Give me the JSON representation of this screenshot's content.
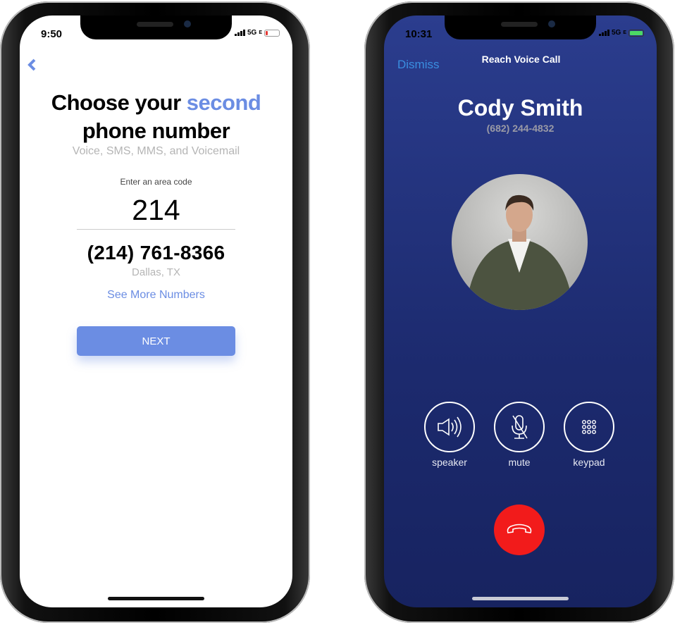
{
  "left_phone": {
    "status": {
      "time": "9:50",
      "network": "5G",
      "network_suffix": "E",
      "battery_color": "#e53935"
    },
    "back_icon": "chevron-left-icon",
    "title_part1": "Choose your ",
    "title_highlight": "second",
    "title_line2": "phone number",
    "subtitle": "Voice, SMS, MMS, and Voicemail",
    "area_code_label": "Enter an area code",
    "area_code_value": "214",
    "phone_number": "(214) 761-8366",
    "location": "Dallas, TX",
    "see_more": "See More Numbers",
    "next_button": "NEXT",
    "accent": "#6b8de3"
  },
  "right_phone": {
    "status": {
      "time": "10:31",
      "network": "5G",
      "network_suffix": "E",
      "battery_color": "#4cd964"
    },
    "dismiss": "Dismiss",
    "header_title": "Reach Voice Call",
    "caller_name": "Cody Smith",
    "caller_number": "(682) 244-4832",
    "controls": [
      {
        "label": "speaker",
        "icon": "speaker-icon"
      },
      {
        "label": "mute",
        "icon": "microphone-muted-icon"
      },
      {
        "label": "keypad",
        "icon": "keypad-icon"
      }
    ],
    "end_call_icon": "phone-hangup-icon",
    "end_call_color": "#f21b1b"
  }
}
